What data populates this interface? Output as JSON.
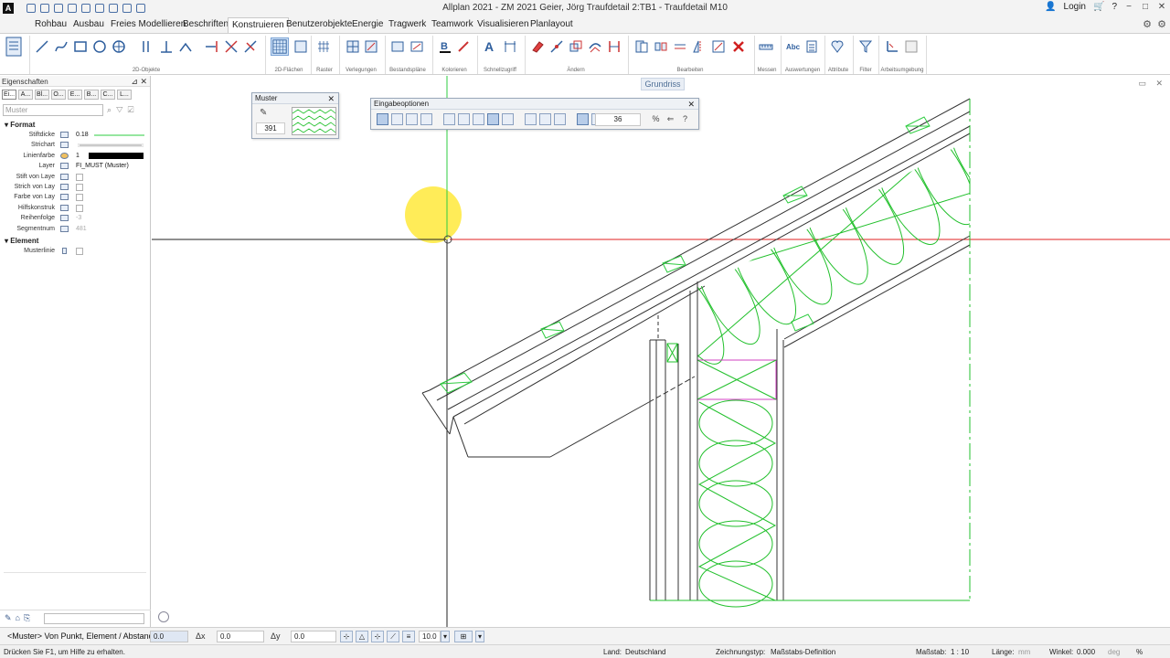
{
  "window": {
    "title": "Allplan 2021 - ZM 2021 Geier, Jörg Traufdetail 2:TB1 - Traufdetail M10",
    "login_label": "Login",
    "minimize_glyph": "−",
    "maximize_glyph": "□",
    "close_glyph": "✕",
    "app_letter": "A"
  },
  "ribbon": {
    "tabs": [
      "Rohbau",
      "Ausbau",
      "Freies Modellieren",
      "Beschriften",
      "Konstruieren",
      "Benutzerobjekte",
      "Energie",
      "Tragwerk",
      "Teamwork",
      "Visualisieren",
      "Planlayout"
    ],
    "active_tab": "Konstruieren",
    "groups": [
      "2D-Objekte",
      "2D-Flächen",
      "Raster",
      "Verlegungen",
      "Bestandspläne",
      "Kolorieren",
      "Schnellzugriff",
      "Ändern",
      "Bearbeiten",
      "Messen",
      "Auswertungen",
      "Attribute",
      "Filter",
      "Arbeitsumgebung"
    ]
  },
  "properties": {
    "header": "Eigenschaften",
    "pin_glyph": "⊿",
    "close_glyph": "✕",
    "tabs": [
      "Ei...",
      "A...",
      "Bl...",
      "O...",
      "E...",
      "B...",
      "C...",
      "L..."
    ],
    "filter_placeholder": "Muster",
    "sections": [
      {
        "title": "Format",
        "rows": [
          {
            "label": "Stiftdicke",
            "value": "0.18"
          },
          {
            "label": "Strichart",
            "value": ""
          },
          {
            "label": "Linienfarbe",
            "value": "1"
          },
          {
            "label": "Layer",
            "value": "FI_MUST (Muster)"
          },
          {
            "label": "Stift von Laye",
            "value": ""
          },
          {
            "label": "Strich von Lay",
            "value": ""
          },
          {
            "label": "Farbe von Lay",
            "value": ""
          },
          {
            "label": "Hilfskonstruk",
            "value": ""
          },
          {
            "label": "Reihenfolge",
            "value": "-3"
          },
          {
            "label": "Segmentnum",
            "value": "481"
          }
        ]
      },
      {
        "title": "Element",
        "rows": [
          {
            "label": "Musterlinie",
            "value": ""
          }
        ]
      }
    ]
  },
  "muster_palette": {
    "title": "Muster",
    "number": "391",
    "close_glyph": "✕"
  },
  "eingabe_palette": {
    "title": "Eingabeoptionen",
    "value": "36",
    "close_glyph": "✕"
  },
  "canvas": {
    "view_label": "Grundriss"
  },
  "dialog": {
    "prompt": "<Muster> Von Punkt, Element / Abstand",
    "abstand_value": "0.0",
    "dx_label": "Δx",
    "dx_value": "0.0",
    "dy_label": "Δy",
    "dy_value": "0.0",
    "zoom_value": "10.0"
  },
  "status": {
    "help": "Drücken Sie F1, um Hilfe zu erhalten.",
    "land_label": "Land:",
    "land_value": "Deutschland",
    "zeichnungstyp_label": "Zeichnungstyp:",
    "zeichnungstyp_value": "Maßstabs-Definition",
    "massstab_label": "Maßstab:",
    "massstab_value": "1 : 10",
    "laenge_label": "Länge:",
    "laenge_unit": "mm",
    "winkel_label": "Winkel:",
    "winkel_value": "0.000",
    "winkel_unit": "deg",
    "percent_label": "%"
  },
  "colors": {
    "ribbon_accent": "#2f5f9e",
    "crosshair_green": "#2ecc40",
    "crosshair_red": "#e02020",
    "insulation_green": "#22c02c",
    "highlight_yellow": "#ffe93b",
    "magenta_outline": "#d040c0"
  }
}
